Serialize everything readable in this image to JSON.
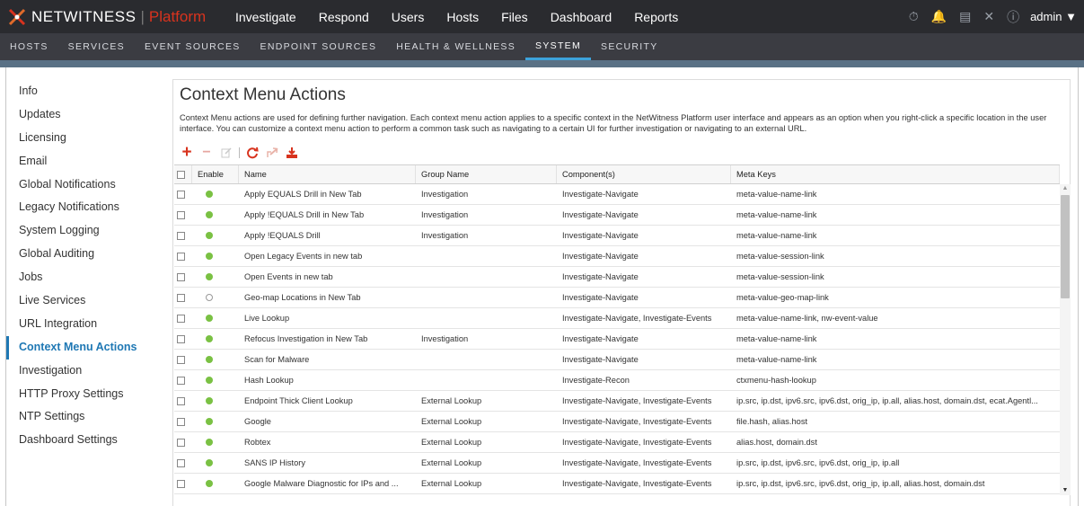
{
  "header": {
    "brand": "NETWITNESS",
    "separator": "|",
    "platform": "Platform",
    "nav": [
      "Investigate",
      "Respond",
      "Users",
      "Hosts",
      "Files",
      "Dashboard",
      "Reports"
    ],
    "user": "admin",
    "icons": [
      "timer-icon",
      "bell-icon",
      "notes-icon",
      "tools-icon",
      "help-icon"
    ]
  },
  "subnav": [
    "HOSTS",
    "SERVICES",
    "EVENT SOURCES",
    "ENDPOINT SOURCES",
    "HEALTH & WELLNESS",
    "SYSTEM",
    "SECURITY"
  ],
  "sidebar": {
    "items": [
      "Info",
      "Updates",
      "Licensing",
      "Email",
      "Global Notifications",
      "Legacy Notifications",
      "System Logging",
      "Global Auditing",
      "Jobs",
      "Live Services",
      "URL Integration",
      "Context Menu Actions",
      "Investigation",
      "HTTP Proxy Settings",
      "NTP Settings",
      "Dashboard Settings"
    ],
    "active": "Context Menu Actions"
  },
  "page": {
    "title": "Context Menu Actions",
    "description": "Context Menu actions are used for defining further navigation. Each context menu action applies to a specific context in the NetWitness Platform user interface and appears as an option when you right-click a specific location in the user interface. You can customize a context menu action to perform a common task such as navigating to a certain UI for further investigation or navigating to an external URL."
  },
  "colors": {
    "accent": "#3da3db",
    "active_link": "#1f78b4",
    "enabled_dot": "#7ac143",
    "brand_red": "#d8331e"
  },
  "table": {
    "headers": [
      "",
      "Enable",
      "Name",
      "Group Name",
      "Component(s)",
      "Meta Keys"
    ],
    "rows": [
      {
        "enabled": true,
        "name": "Apply EQUALS Drill in New Tab",
        "group": "Investigation",
        "component": "Investigate-Navigate",
        "meta": "meta-value-name-link"
      },
      {
        "enabled": true,
        "name": "Apply !EQUALS Drill in New Tab",
        "group": "Investigation",
        "component": "Investigate-Navigate",
        "meta": "meta-value-name-link"
      },
      {
        "enabled": true,
        "name": "Apply !EQUALS Drill",
        "group": "Investigation",
        "component": "Investigate-Navigate",
        "meta": "meta-value-name-link"
      },
      {
        "enabled": true,
        "name": "Open Legacy Events in new tab",
        "group": "",
        "component": "Investigate-Navigate",
        "meta": "meta-value-session-link"
      },
      {
        "enabled": true,
        "name": "Open Events in new tab",
        "group": "",
        "component": "Investigate-Navigate",
        "meta": "meta-value-session-link"
      },
      {
        "enabled": false,
        "name": "Geo-map Locations in New Tab",
        "group": "",
        "component": "Investigate-Navigate",
        "meta": "meta-value-geo-map-link"
      },
      {
        "enabled": true,
        "name": "Live Lookup",
        "group": "",
        "component": "Investigate-Navigate, Investigate-Events",
        "meta": "meta-value-name-link, nw-event-value"
      },
      {
        "enabled": true,
        "name": "Refocus Investigation in New Tab",
        "group": "Investigation",
        "component": "Investigate-Navigate",
        "meta": "meta-value-name-link"
      },
      {
        "enabled": true,
        "name": "Scan for Malware",
        "group": "",
        "component": "Investigate-Navigate",
        "meta": "meta-value-name-link"
      },
      {
        "enabled": true,
        "name": "Hash Lookup",
        "group": "",
        "component": "Investigate-Recon",
        "meta": "ctxmenu-hash-lookup"
      },
      {
        "enabled": true,
        "name": "Endpoint Thick Client Lookup",
        "group": "External Lookup",
        "component": "Investigate-Navigate, Investigate-Events",
        "meta": "ip.src, ip.dst, ipv6.src, ipv6.dst, orig_ip, ip.all, alias.host, domain.dst, ecat.Agentl..."
      },
      {
        "enabled": true,
        "name": "Google",
        "group": "External Lookup",
        "component": "Investigate-Navigate, Investigate-Events",
        "meta": "file.hash, alias.host"
      },
      {
        "enabled": true,
        "name": "Robtex",
        "group": "External Lookup",
        "component": "Investigate-Navigate, Investigate-Events",
        "meta": "alias.host, domain.dst"
      },
      {
        "enabled": true,
        "name": "SANS IP History",
        "group": "External Lookup",
        "component": "Investigate-Navigate, Investigate-Events",
        "meta": "ip.src, ip.dst, ipv6.src, ipv6.dst, orig_ip, ip.all"
      },
      {
        "enabled": true,
        "name": "Google Malware Diagnostic for IPs and ...",
        "group": "External Lookup",
        "component": "Investigate-Navigate, Investigate-Events",
        "meta": "ip.src, ip.dst, ipv6.src, ipv6.dst, orig_ip, ip.all, alias.host, domain.dst"
      }
    ]
  }
}
